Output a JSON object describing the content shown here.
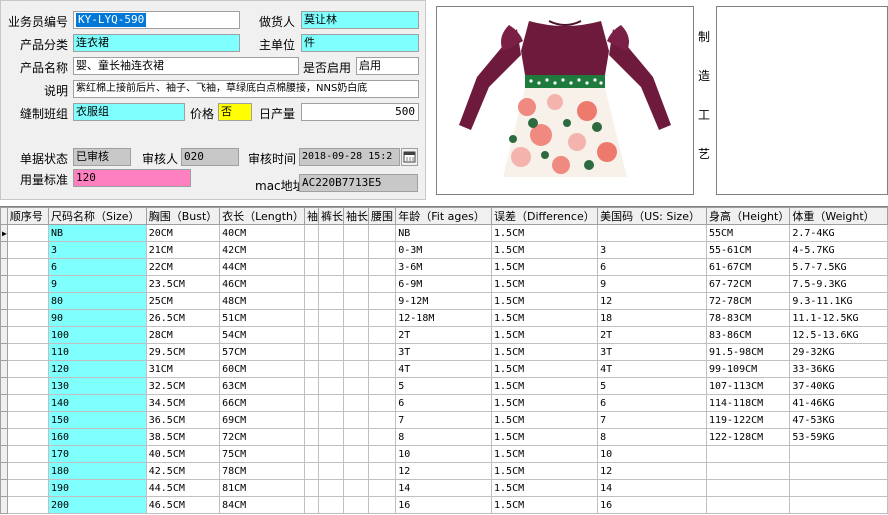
{
  "form": {
    "salesman_no_label": "业务员编号",
    "salesman_no_value": "KY-LYQ-590",
    "supplier_label": "做货人",
    "supplier_value": "莫让林",
    "category_label": "产品分类",
    "category_value": "连衣裙",
    "unit_label": "主单位",
    "unit_value": "件",
    "name_label": "产品名称",
    "name_value": "婴、童长袖连衣裙",
    "enabled_label": "是否启用",
    "enabled_value": "启用",
    "desc_label": "说明",
    "desc_value": "紫红棉上接前后片、袖子、飞袖，草绿底白点棉腰接，NNS奶白底",
    "team_label": "缝制班组",
    "team_value": "衣服组",
    "price_label": "价格",
    "price_value": "否",
    "daily_label": "日产量",
    "daily_value": "500",
    "status_label": "单据状态",
    "status_value": "已审核",
    "auditor_label": "审核人",
    "auditor_value": "020",
    "audit_time_label": "审核时间",
    "audit_time_value": "2018-09-28  15:2",
    "usage_label": "用量标准",
    "usage_value": "120",
    "mac_label": "mac地址",
    "mac_value": "AC220B7713E5"
  },
  "craft_label": [
    "制",
    "造",
    "工",
    "艺"
  ],
  "icons": {
    "calendar": "calendar-icon",
    "row_pointer": "row-pointer-icon"
  },
  "colors": {
    "cyan": "#80ffff",
    "pink": "#ff80c0",
    "yellow": "#ffff00",
    "gray": "#c8c8c8"
  },
  "table": {
    "headers": [
      "顺序号",
      "尺码名称（Size）",
      "胸围（Bust）",
      "衣长（Length）",
      "袖",
      "裤长",
      "袖长",
      "腰围",
      "年龄（Fit ages）",
      "误差（Difference）",
      "美国码（US: Size）",
      "身高（Height）",
      "体重（Weight）"
    ],
    "rows": [
      [
        "",
        "NB",
        "20CM",
        "40CM",
        "",
        "",
        "",
        "",
        "NB",
        "1.5CM",
        "",
        "55CM",
        "2.7-4KG"
      ],
      [
        "",
        "3",
        "21CM",
        "42CM",
        "",
        "",
        "",
        "",
        "0-3M",
        "1.5CM",
        "3",
        "55-61CM",
        "4-5.7KG"
      ],
      [
        "",
        "6",
        "22CM",
        "44CM",
        "",
        "",
        "",
        "",
        "3-6M",
        "1.5CM",
        "6",
        "61-67CM",
        "5.7-7.5KG"
      ],
      [
        "",
        "9",
        "23.5CM",
        "46CM",
        "",
        "",
        "",
        "",
        "6-9M",
        "1.5CM",
        "9",
        "67-72CM",
        "7.5-9.3KG"
      ],
      [
        "",
        "80",
        "25CM",
        "48CM",
        "",
        "",
        "",
        "",
        "9-12M",
        "1.5CM",
        "12",
        "72-78CM",
        "9.3-11.1KG"
      ],
      [
        "",
        "90",
        "26.5CM",
        "51CM",
        "",
        "",
        "",
        "",
        "12-18M",
        "1.5CM",
        "18",
        "78-83CM",
        "11.1-12.5KG"
      ],
      [
        "",
        "100",
        "28CM",
        "54CM",
        "",
        "",
        "",
        "",
        "2T",
        "1.5CM",
        "2T",
        "83-86CM",
        "12.5-13.6KG"
      ],
      [
        "",
        "110",
        "29.5CM",
        "57CM",
        "",
        "",
        "",
        "",
        "3T",
        "1.5CM",
        "3T",
        "91.5-98CM",
        "29-32KG"
      ],
      [
        "",
        "120",
        "31CM",
        "60CM",
        "",
        "",
        "",
        "",
        "4T",
        "1.5CM",
        "4T",
        "99-109CM",
        "33-36KG"
      ],
      [
        "",
        "130",
        "32.5CM",
        "63CM",
        "",
        "",
        "",
        "",
        "5",
        "1.5CM",
        "5",
        "107-113CM",
        "37-40KG"
      ],
      [
        "",
        "140",
        "34.5CM",
        "66CM",
        "",
        "",
        "",
        "",
        "6",
        "1.5CM",
        "6",
        "114-118CM",
        "41-46KG"
      ],
      [
        "",
        "150",
        "36.5CM",
        "69CM",
        "",
        "",
        "",
        "",
        "7",
        "1.5CM",
        "7",
        "119-122CM",
        "47-53KG"
      ],
      [
        "",
        "160",
        "38.5CM",
        "72CM",
        "",
        "",
        "",
        "",
        "8",
        "1.5CM",
        "8",
        "122-128CM",
        "53-59KG"
      ],
      [
        "",
        "170",
        "40.5CM",
        "75CM",
        "",
        "",
        "",
        "",
        "10",
        "1.5CM",
        "10",
        "",
        ""
      ],
      [
        "",
        "180",
        "42.5CM",
        "78CM",
        "",
        "",
        "",
        "",
        "12",
        "1.5CM",
        "12",
        "",
        ""
      ],
      [
        "",
        "190",
        "44.5CM",
        "81CM",
        "",
        "",
        "",
        "",
        "14",
        "1.5CM",
        "14",
        "",
        ""
      ],
      [
        "",
        "200",
        "46.5CM",
        "84CM",
        "",
        "",
        "",
        "",
        "16",
        "1.5CM",
        "16",
        "",
        ""
      ]
    ]
  }
}
